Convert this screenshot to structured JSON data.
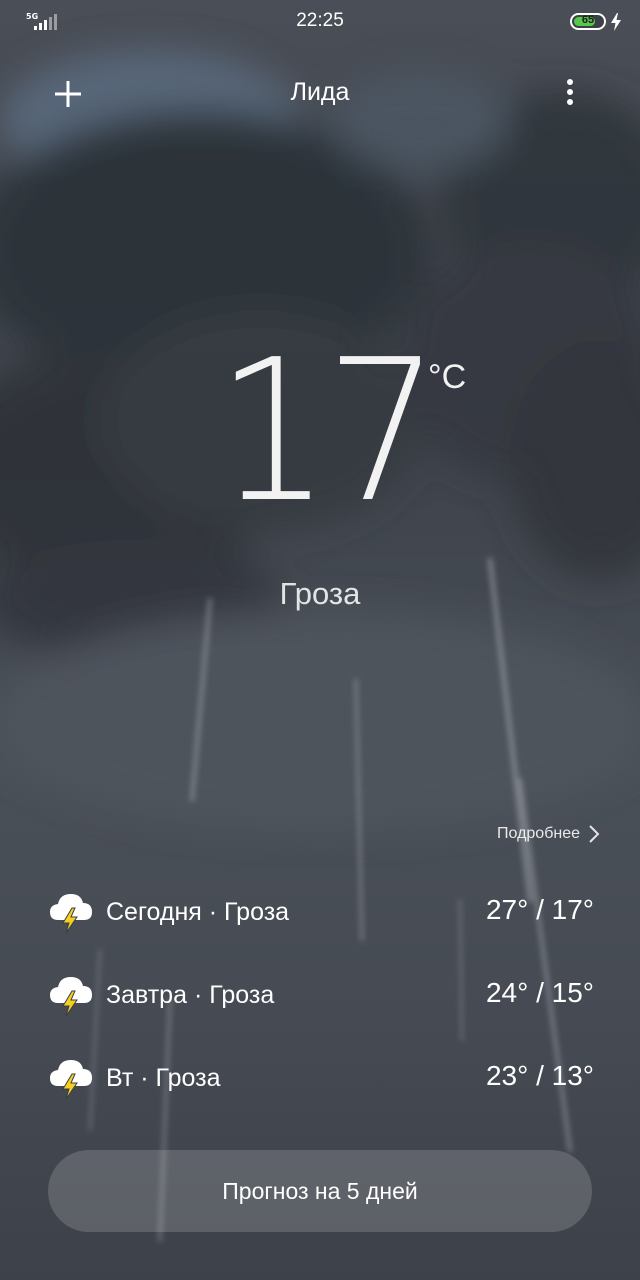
{
  "status_bar": {
    "network": "5G",
    "time": "22:25",
    "battery": "65"
  },
  "header": {
    "city": "Лида"
  },
  "current": {
    "temperature": "17",
    "unit": "°C",
    "condition": "Гроза"
  },
  "details_link": "Подробнее",
  "forecast": [
    {
      "label": "Сегодня · Гроза",
      "range": "27° / 17°",
      "icon": "thunderstorm-icon"
    },
    {
      "label": "Завтра · Гроза",
      "range": "24° / 15°",
      "icon": "thunderstorm-icon"
    },
    {
      "label": "Вт · Гроза",
      "range": "23° / 13°",
      "icon": "thunderstorm-icon"
    }
  ],
  "forecast_button": "Прогноз на 5 дней",
  "colors": {
    "battery_fill": "#58c84a",
    "bolt": "#f5d020"
  }
}
